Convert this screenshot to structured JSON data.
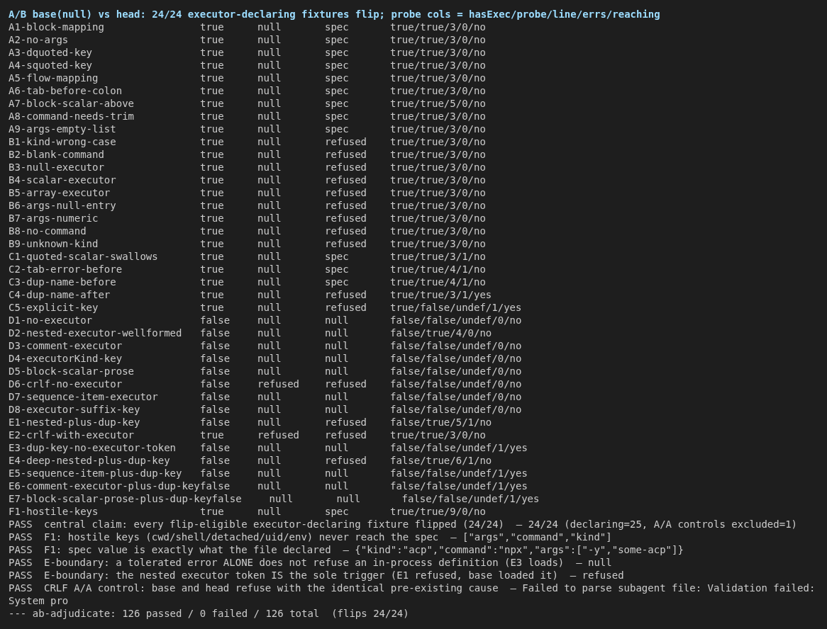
{
  "header": "A/B base(null) vs head: 24/24 executor-declaring fixtures flip; probe cols = hasExec/probe/line/errs/reaching",
  "rows": [
    {
      "name": "A1-block-mapping",
      "has_exec": "true",
      "base": "null",
      "head": "spec",
      "probe": "true/true/3/0/no"
    },
    {
      "name": "A2-no-args",
      "has_exec": "true",
      "base": "null",
      "head": "spec",
      "probe": "true/true/3/0/no"
    },
    {
      "name": "A3-dquoted-key",
      "has_exec": "true",
      "base": "null",
      "head": "spec",
      "probe": "true/true/3/0/no"
    },
    {
      "name": "A4-squoted-key",
      "has_exec": "true",
      "base": "null",
      "head": "spec",
      "probe": "true/true/3/0/no"
    },
    {
      "name": "A5-flow-mapping",
      "has_exec": "true",
      "base": "null",
      "head": "spec",
      "probe": "true/true/3/0/no"
    },
    {
      "name": "A6-tab-before-colon",
      "has_exec": "true",
      "base": "null",
      "head": "spec",
      "probe": "true/true/3/0/no"
    },
    {
      "name": "A7-block-scalar-above",
      "has_exec": "true",
      "base": "null",
      "head": "spec",
      "probe": "true/true/5/0/no"
    },
    {
      "name": "A8-command-needs-trim",
      "has_exec": "true",
      "base": "null",
      "head": "spec",
      "probe": "true/true/3/0/no"
    },
    {
      "name": "A9-args-empty-list",
      "has_exec": "true",
      "base": "null",
      "head": "spec",
      "probe": "true/true/3/0/no"
    },
    {
      "name": "B1-kind-wrong-case",
      "has_exec": "true",
      "base": "null",
      "head": "refused",
      "probe": "true/true/3/0/no"
    },
    {
      "name": "B2-blank-command",
      "has_exec": "true",
      "base": "null",
      "head": "refused",
      "probe": "true/true/3/0/no"
    },
    {
      "name": "B3-null-executor",
      "has_exec": "true",
      "base": "null",
      "head": "refused",
      "probe": "true/true/3/0/no"
    },
    {
      "name": "B4-scalar-executor",
      "has_exec": "true",
      "base": "null",
      "head": "refused",
      "probe": "true/true/3/0/no"
    },
    {
      "name": "B5-array-executor",
      "has_exec": "true",
      "base": "null",
      "head": "refused",
      "probe": "true/true/3/0/no"
    },
    {
      "name": "B6-args-null-entry",
      "has_exec": "true",
      "base": "null",
      "head": "refused",
      "probe": "true/true/3/0/no"
    },
    {
      "name": "B7-args-numeric",
      "has_exec": "true",
      "base": "null",
      "head": "refused",
      "probe": "true/true/3/0/no"
    },
    {
      "name": "B8-no-command",
      "has_exec": "true",
      "base": "null",
      "head": "refused",
      "probe": "true/true/3/0/no"
    },
    {
      "name": "B9-unknown-kind",
      "has_exec": "true",
      "base": "null",
      "head": "refused",
      "probe": "true/true/3/0/no"
    },
    {
      "name": "C1-quoted-scalar-swallows",
      "has_exec": "true",
      "base": "null",
      "head": "spec",
      "probe": "true/true/3/1/no"
    },
    {
      "name": "C2-tab-error-before",
      "has_exec": "true",
      "base": "null",
      "head": "spec",
      "probe": "true/true/4/1/no"
    },
    {
      "name": "C3-dup-name-before",
      "has_exec": "true",
      "base": "null",
      "head": "spec",
      "probe": "true/true/4/1/no"
    },
    {
      "name": "C4-dup-name-after",
      "has_exec": "true",
      "base": "null",
      "head": "refused",
      "probe": "true/true/3/1/yes"
    },
    {
      "name": "C5-explicit-key",
      "has_exec": "true",
      "base": "null",
      "head": "refused",
      "probe": "true/false/undef/1/yes"
    },
    {
      "name": "D1-no-executor",
      "has_exec": "false",
      "base": "null",
      "head": "null",
      "probe": "false/false/undef/0/no"
    },
    {
      "name": "D2-nested-executor-wellformed",
      "has_exec": "false",
      "base": "null",
      "head": "null",
      "probe": "false/true/4/0/no"
    },
    {
      "name": "D3-comment-executor",
      "has_exec": "false",
      "base": "null",
      "head": "null",
      "probe": "false/false/undef/0/no"
    },
    {
      "name": "D4-executorKind-key",
      "has_exec": "false",
      "base": "null",
      "head": "null",
      "probe": "false/false/undef/0/no"
    },
    {
      "name": "D5-block-scalar-prose",
      "has_exec": "false",
      "base": "null",
      "head": "null",
      "probe": "false/false/undef/0/no"
    },
    {
      "name": "D6-crlf-no-executor",
      "has_exec": "false",
      "base": "refused",
      "head": "refused",
      "probe": "false/false/undef/0/no"
    },
    {
      "name": "D7-sequence-item-executor",
      "has_exec": "false",
      "base": "null",
      "head": "null",
      "probe": "false/false/undef/0/no"
    },
    {
      "name": "D8-executor-suffix-key",
      "has_exec": "false",
      "base": "null",
      "head": "null",
      "probe": "false/false/undef/0/no"
    },
    {
      "name": "E1-nested-plus-dup-key",
      "has_exec": "false",
      "base": "null",
      "head": "refused",
      "probe": "false/true/5/1/no"
    },
    {
      "name": "E2-crlf-with-executor",
      "has_exec": "true",
      "base": "refused",
      "head": "refused",
      "probe": "true/true/3/0/no"
    },
    {
      "name": "E3-dup-key-no-executor-token",
      "has_exec": "false",
      "base": "null",
      "head": "null",
      "probe": "false/false/undef/1/yes"
    },
    {
      "name": "E4-deep-nested-plus-dup-key",
      "has_exec": "false",
      "base": "null",
      "head": "refused",
      "probe": "false/true/6/1/no"
    },
    {
      "name": "E5-sequence-item-plus-dup-key",
      "has_exec": "false",
      "base": "null",
      "head": "null",
      "probe": "false/false/undef/1/yes"
    },
    {
      "name": "E6-comment-executor-plus-dup-key",
      "has_exec": "false",
      "base": "null",
      "head": "null",
      "probe": "false/false/undef/1/yes"
    },
    {
      "name": "E7-block-scalar-prose-plus-dup-key",
      "has_exec": "false",
      "base": "null",
      "head": "null",
      "probe": "false/false/undef/1/yes"
    },
    {
      "name": "F1-hostile-keys",
      "has_exec": "true",
      "base": "null",
      "head": "spec",
      "probe": "true/true/9/0/no"
    }
  ],
  "checks": [
    {
      "status": "PASS",
      "text": "central claim: every flip-eligible executor-declaring fixture flipped (24/24)  — 24/24 (declaring=25, A/A controls excluded=1)"
    },
    {
      "status": "PASS",
      "text": "F1: hostile keys (cwd/shell/detached/uid/env) never reach the spec  — [\"args\",\"command\",\"kind\"]"
    },
    {
      "status": "PASS",
      "text": "F1: spec value is exactly what the file declared  — {\"kind\":\"acp\",\"command\":\"npx\",\"args\":[\"-y\",\"some-acp\"]}"
    },
    {
      "status": "PASS",
      "text": "E-boundary: a tolerated error ALONE does not refuse an in-process definition (E3 loads)  — null"
    },
    {
      "status": "PASS",
      "text": "E-boundary: the nested executor token IS the sole trigger (E1 refused, base loaded it)  — refused"
    },
    {
      "status": "PASS",
      "text": "CRLF A/A control: base and head refuse with the identical pre-existing cause  — Failed to parse subagent file: Validation failed:"
    }
  ],
  "continuation": "System pro",
  "summary": "--- ab-adjudicate: 126 passed / 0 failed / 126 total  (flips 24/24)"
}
